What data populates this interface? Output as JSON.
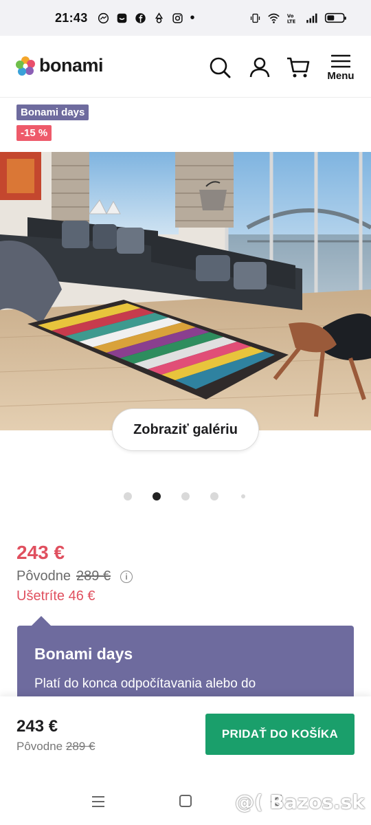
{
  "status_bar": {
    "time": "21:43",
    "dot": "•",
    "app_icons": [
      "messenger-icon",
      "bonami-notif-icon",
      "facebook-icon",
      "recycle-icon",
      "instagram-icon"
    ],
    "right_icons": [
      "vibrate-icon",
      "wifi-icon",
      "volte-icon",
      "signal-icon",
      "battery-icon"
    ]
  },
  "header": {
    "logo_text": "bonami",
    "icons": [
      "search-icon",
      "user-icon",
      "cart-icon",
      "hamburger-icon"
    ],
    "menu_label": "Menu"
  },
  "badges": {
    "promo": "Bonami days",
    "discount": "-15 %"
  },
  "gallery": {
    "button_label": "Zobraziť galériu",
    "slide_count": 5,
    "active_slide": 2
  },
  "pricing": {
    "price": "243 €",
    "original_label": "Pôvodne",
    "original_price": "289 €",
    "info_glyph": "i",
    "savings": "Ušetríte 46 €"
  },
  "promo_box": {
    "title": "Bonami days",
    "text": "Platí do konca odpočítavania alebo do"
  },
  "sticky_bar": {
    "price": "243 €",
    "original_label": "Pôvodne",
    "original_price": "289 €",
    "cart_button": "PRIDAŤ DO KOŠÍKA"
  },
  "watermark": "@( Bazos.sk",
  "colors": {
    "brand_purple": "#6e6b9e",
    "sale_red": "#e0505f",
    "cta_green": "#1a9f6b"
  }
}
